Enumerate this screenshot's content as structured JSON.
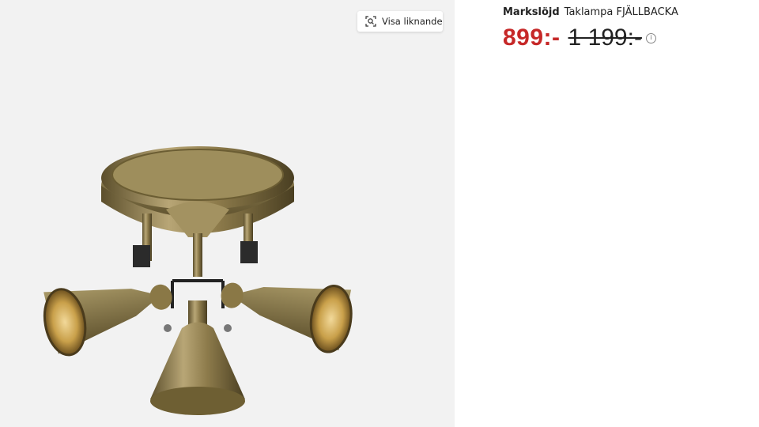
{
  "gallery": {
    "similar_button_label": "Visa liknande",
    "similar_icon": "visual-search-icon",
    "image_subject": "brass-three-spotlight-ceiling-lamp"
  },
  "product": {
    "brand": "Markslöjd",
    "name": "Taklampa FJÄLLBACKA",
    "price_current": "899:-",
    "price_original": "1 199:-",
    "price_info_icon": "info-icon"
  },
  "colors": {
    "sale_price": "#c62828",
    "text": "#222222",
    "gallery_background": "#f2f2f2"
  }
}
